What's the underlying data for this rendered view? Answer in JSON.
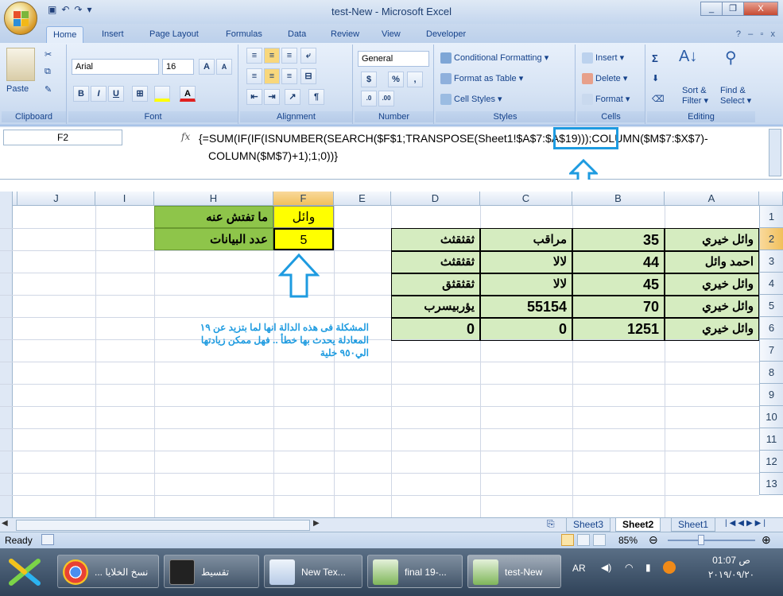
{
  "window": {
    "title": "test-New - Microsoft Excel",
    "minimize": "_",
    "restore": "❐",
    "close": "X"
  },
  "tabs": [
    "Home",
    "Insert",
    "Page Layout",
    "Formulas",
    "Data",
    "Review",
    "View",
    "Developer"
  ],
  "active_tab": "Home",
  "ribbon": {
    "clipboard": {
      "label": "Clipboard",
      "paste": "Paste"
    },
    "font": {
      "label": "Font",
      "name": "Arial",
      "size": "16",
      "bold": "B",
      "italic": "I",
      "underline": "U",
      "grow": "A",
      "shrink": "A"
    },
    "alignment": {
      "label": "Alignment"
    },
    "number": {
      "label": "Number",
      "format": "General",
      "percent": "%",
      "comma": ","
    },
    "styles": {
      "label": "Styles",
      "conditional": "Conditional Formatting",
      "table": "Format as Table",
      "cell_styles": "Cell Styles"
    },
    "cells": {
      "label": "Cells",
      "insert": "Insert",
      "delete": "Delete",
      "format": "Format"
    },
    "editing": {
      "label": "Editing",
      "sigma": "Σ",
      "sort": "Sort &",
      "sort2": "Filter",
      "find": "Find &",
      "find2": "Select"
    }
  },
  "formula_bar": {
    "name_box": "F2",
    "fx": "fx",
    "formula_line1": "{=SUM(IF(IF(ISNUMBER(SEARCH($F$1;TRANSPOSE(Sheet1!$A$7:$A$19)));COLUMN($M$7:$X$7)-",
    "formula_line2": "COLUMN($M$7)+1);1;0))}"
  },
  "columns": [
    "J",
    "I",
    "H",
    "F",
    "E",
    "D",
    "C",
    "B",
    "A"
  ],
  "rows": [
    "1",
    "2",
    "3",
    "4",
    "5",
    "6",
    "7",
    "8",
    "9",
    "10",
    "11",
    "12",
    "13"
  ],
  "cells": {
    "H1": "ما تفتش عنه",
    "H2": "عدد البيانات",
    "F1": "وائل",
    "F2": "5",
    "table": [
      {
        "A": "وائل خيري",
        "B": "35",
        "C": "مراقب",
        "D": "ثقثقثث"
      },
      {
        "A": "احمد وائل",
        "B": "44",
        "C": "لالا",
        "D": "ثقثقثث"
      },
      {
        "A": "وائل خيري",
        "B": "45",
        "C": "لالا",
        "D": "ثقثقثق"
      },
      {
        "A": "وائل خيري",
        "B": "70",
        "C": "55154",
        "D": "يؤربيسرب"
      },
      {
        "A": "وائل خيري",
        "B": "1251",
        "C": "0",
        "D": "0"
      }
    ]
  },
  "note": {
    "line1": "المشكلة فى هذه الدالة انها لما بتزيد عن ١٩",
    "line2": "المعادلة يحدث بها خطأ .. فهل ممكن زيادتها",
    "line3": "الي٩٥٠ خلية"
  },
  "sheets": [
    "Sheet3",
    "Sheet2",
    "Sheet1"
  ],
  "active_sheet": "Sheet2",
  "status": {
    "ready": "Ready",
    "zoom": "85%"
  },
  "taskbar": {
    "items": [
      "... نسخ الخلايا",
      "تقسيط",
      "New Tex...",
      "final 19-...",
      "test-New"
    ],
    "lang": "AR",
    "time": "ص 01:07",
    "date": "٢٠١٩/٠٩/٢٠"
  },
  "colors": {
    "green": "#8ec54a",
    "yellow": "#ffff00",
    "highlight": "#1e9be0"
  }
}
